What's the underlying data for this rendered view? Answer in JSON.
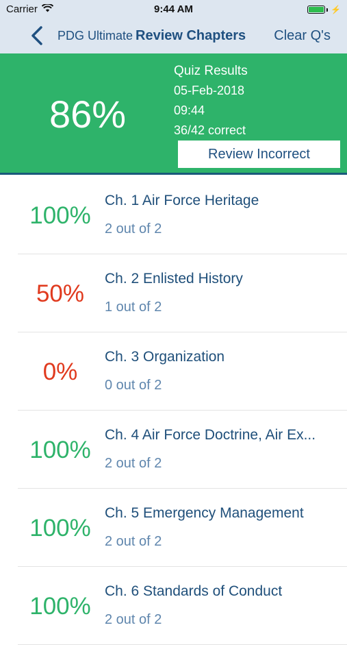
{
  "status_bar": {
    "carrier": "Carrier",
    "time": "9:44 AM"
  },
  "nav": {
    "back_label": "PDG Ultimate",
    "title": "Review Chapters",
    "right_button": "Clear Q's"
  },
  "summary": {
    "score": "86%",
    "title": "Quiz Results",
    "date": "05-Feb-2018",
    "time": "09:44",
    "correct": "36/42 correct",
    "review_button": "Review Incorrect"
  },
  "colors": {
    "green": "#2eb36a",
    "red": "#e03a1e",
    "nav_blue": "#1f5080"
  },
  "chapters": [
    {
      "pct": "100%",
      "title": "Ch. 1 Air Force Heritage",
      "score": "2 out of 2",
      "status": "pass"
    },
    {
      "pct": "50%",
      "title": "Ch. 2 Enlisted History",
      "score": "1 out of 2",
      "status": "fail"
    },
    {
      "pct": "0%",
      "title": "Ch. 3 Organization",
      "score": "0 out of 2",
      "status": "fail"
    },
    {
      "pct": "100%",
      "title": "Ch. 4 Air Force Doctrine, Air Ex...",
      "score": "2 out of 2",
      "status": "pass"
    },
    {
      "pct": "100%",
      "title": "Ch. 5 Emergency Management",
      "score": "2 out of 2",
      "status": "pass"
    },
    {
      "pct": "100%",
      "title": "Ch. 6 Standards of Conduct",
      "score": "2 out of 2",
      "status": "pass"
    }
  ]
}
